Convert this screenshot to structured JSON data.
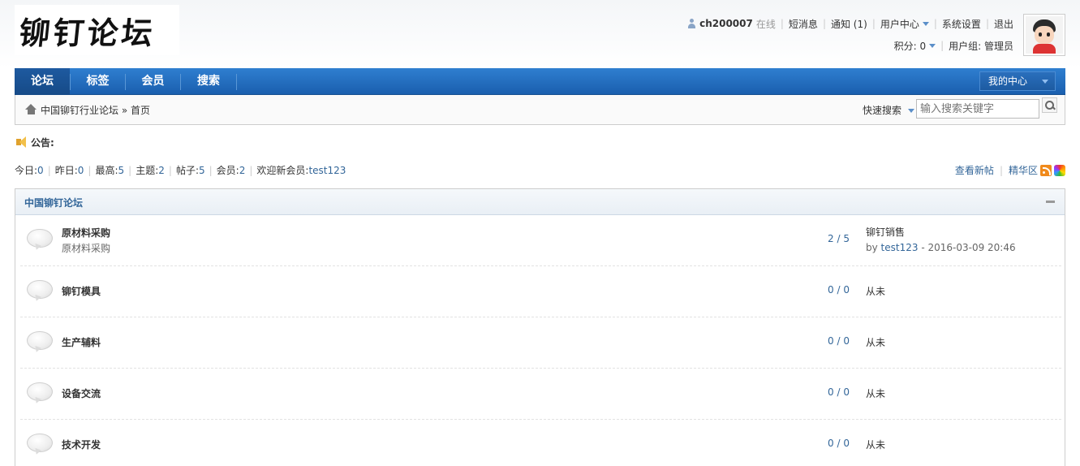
{
  "site": {
    "logo_text": "铆钉论坛"
  },
  "user": {
    "name": "ch200007",
    "status": "在线",
    "links": [
      "短消息",
      "通知 (1)",
      "用户中心",
      "系统设置",
      "退出"
    ],
    "points_label": "积分: 0",
    "group_label": "用户组: 管理员"
  },
  "nav": {
    "items": [
      "论坛",
      "标签",
      "会员",
      "搜索"
    ],
    "my_center": "我的中心"
  },
  "breadcrumb": {
    "root": "中国铆钉行业论坛",
    "sep": "»",
    "current": "首页"
  },
  "search": {
    "quick_label": "快速搜索",
    "placeholder": "输入搜索关键字"
  },
  "notice": {
    "label": "公告:"
  },
  "stats": {
    "today_label": "今日:",
    "today": "0",
    "yesterday_label": "昨日:",
    "yesterday": "0",
    "max_label": "最高:",
    "max": "5",
    "threads_label": "主题:",
    "threads": "2",
    "posts_label": "帖子:",
    "posts": "5",
    "members_label": "会员:",
    "members": "2",
    "newmember_label": "欢迎新会员:",
    "newmember": "test123"
  },
  "right_links": {
    "new_posts": "查看新帖",
    "digest": "精华区"
  },
  "forum_group": {
    "title": "中国铆钉论坛",
    "forums": [
      {
        "name": "原材料采购",
        "desc": "原材料采购",
        "count": "2 / 5",
        "last_title": "铆钉销售",
        "last_by_prefix": "by",
        "last_user": "test123",
        "last_time": "- 2016-03-09 20:46"
      },
      {
        "name": "铆钉模具",
        "desc": "",
        "count": "0 / 0",
        "last_title": "从未",
        "last_by_prefix": "",
        "last_user": "",
        "last_time": ""
      },
      {
        "name": "生产辅料",
        "desc": "",
        "count": "0 / 0",
        "last_title": "从未",
        "last_by_prefix": "",
        "last_user": "",
        "last_time": ""
      },
      {
        "name": "设备交流",
        "desc": "",
        "count": "0 / 0",
        "last_title": "从未",
        "last_by_prefix": "",
        "last_user": "",
        "last_time": ""
      },
      {
        "name": "技术开发",
        "desc": "",
        "count": "0 / 0",
        "last_title": "从未",
        "last_by_prefix": "",
        "last_user": "",
        "last_time": ""
      }
    ]
  }
}
